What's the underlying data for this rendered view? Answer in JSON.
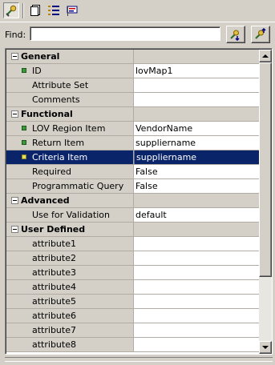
{
  "toolbar": {
    "buttons": [
      {
        "icon": "property-inspector-icon",
        "pressed": true
      },
      {
        "icon": "new-page-icon"
      },
      {
        "icon": "categorized-list-icon"
      },
      {
        "icon": "flag-icon"
      }
    ]
  },
  "find": {
    "label": "Find:",
    "value": "",
    "placeholder": "",
    "buttons": [
      {
        "icon": "find-next-icon"
      },
      {
        "icon": "find-previous-icon"
      }
    ]
  },
  "grid": {
    "rows": [
      {
        "kind": "category",
        "label": "General",
        "value": ""
      },
      {
        "kind": "property",
        "label": "ID",
        "value": "lovMap1",
        "required": true
      },
      {
        "kind": "property",
        "label": "Attribute Set",
        "value": ""
      },
      {
        "kind": "property",
        "label": "Comments",
        "value": ""
      },
      {
        "kind": "category",
        "label": "Functional",
        "value": ""
      },
      {
        "kind": "property",
        "label": "LOV Region Item",
        "value": "VendorName",
        "required": true
      },
      {
        "kind": "property",
        "label": "Return Item",
        "value": "suppliername",
        "required": true
      },
      {
        "kind": "property",
        "label": "Criteria Item",
        "value": "suppliername",
        "required": true,
        "selected": true
      },
      {
        "kind": "property",
        "label": "Required",
        "value": "False"
      },
      {
        "kind": "property",
        "label": "Programmatic Query",
        "value": "False"
      },
      {
        "kind": "category",
        "label": "Advanced",
        "value": ""
      },
      {
        "kind": "property",
        "label": "Use for Validation",
        "value": "default"
      },
      {
        "kind": "category",
        "label": "User Defined",
        "value": ""
      },
      {
        "kind": "property",
        "label": "attribute1",
        "value": ""
      },
      {
        "kind": "property",
        "label": "attribute2",
        "value": ""
      },
      {
        "kind": "property",
        "label": "attribute3",
        "value": ""
      },
      {
        "kind": "property",
        "label": "attribute4",
        "value": ""
      },
      {
        "kind": "property",
        "label": "attribute5",
        "value": ""
      },
      {
        "kind": "property",
        "label": "attribute6",
        "value": ""
      },
      {
        "kind": "property",
        "label": "attribute7",
        "value": ""
      },
      {
        "kind": "property",
        "label": "attribute8",
        "value": ""
      }
    ]
  },
  "colors": {
    "selection": "#0a246a",
    "panel": "#d4d0c8",
    "required_marker": "#3a9a3a"
  }
}
